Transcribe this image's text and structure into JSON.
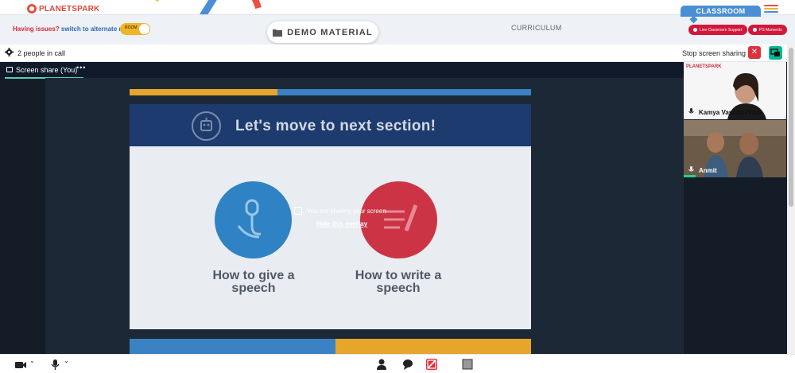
{
  "header": {
    "logo_text": "PLANETSPARK",
    "issues_text": "Having issues?",
    "issues_link": "switch to alternate room",
    "toggle_label": "ROOM",
    "demo_button_label": "DEMO MATERIAL",
    "curriculum_label": "CURRICULUM",
    "classroom_tab_label": "CLASSROOM",
    "live_support_label": "Live Classroom Support",
    "ps_moments_label": "PS Moments",
    "menu_colors": [
      "#e85040",
      "#f0b429",
      "#4a8fd4"
    ]
  },
  "call": {
    "people_count_text": "2 people in call",
    "stop_sharing_label": "Stop screen sharing",
    "screen_share_label": "Screen share (You)",
    "overlay_message": "You are sharing your screen",
    "overlay_link": "Hide this overlay"
  },
  "slide": {
    "title": "Let's move to next section!",
    "options": [
      {
        "label": "How to give a speech",
        "icon": "microphone-icon",
        "color": "#2f83c4"
      },
      {
        "label": "How to write a speech",
        "icon": "notepad-pencil-icon",
        "color": "#cc3446"
      }
    ],
    "strip_colors": [
      "#e6a62b",
      "#3a82c4"
    ]
  },
  "participants": [
    {
      "name": "Kamya Vashist (You)",
      "avatar": "teacher-video",
      "banner_text": "PLANETSPARK"
    },
    {
      "name": "Anmit",
      "avatar": "student-video"
    }
  ],
  "toolbar": {
    "camera_icon": "camera-icon",
    "mic_icon": "microphone-icon",
    "people_icon": "person-icon",
    "chat_icon": "chat-icon",
    "whiteboard_icon": "whiteboard-icon",
    "stop_icon": "square-icon"
  },
  "colors": {
    "accent_blue": "#4a8fd4",
    "alert_red": "#d3173c",
    "share_green": "#00b894",
    "stage_bg": "#141c27"
  }
}
